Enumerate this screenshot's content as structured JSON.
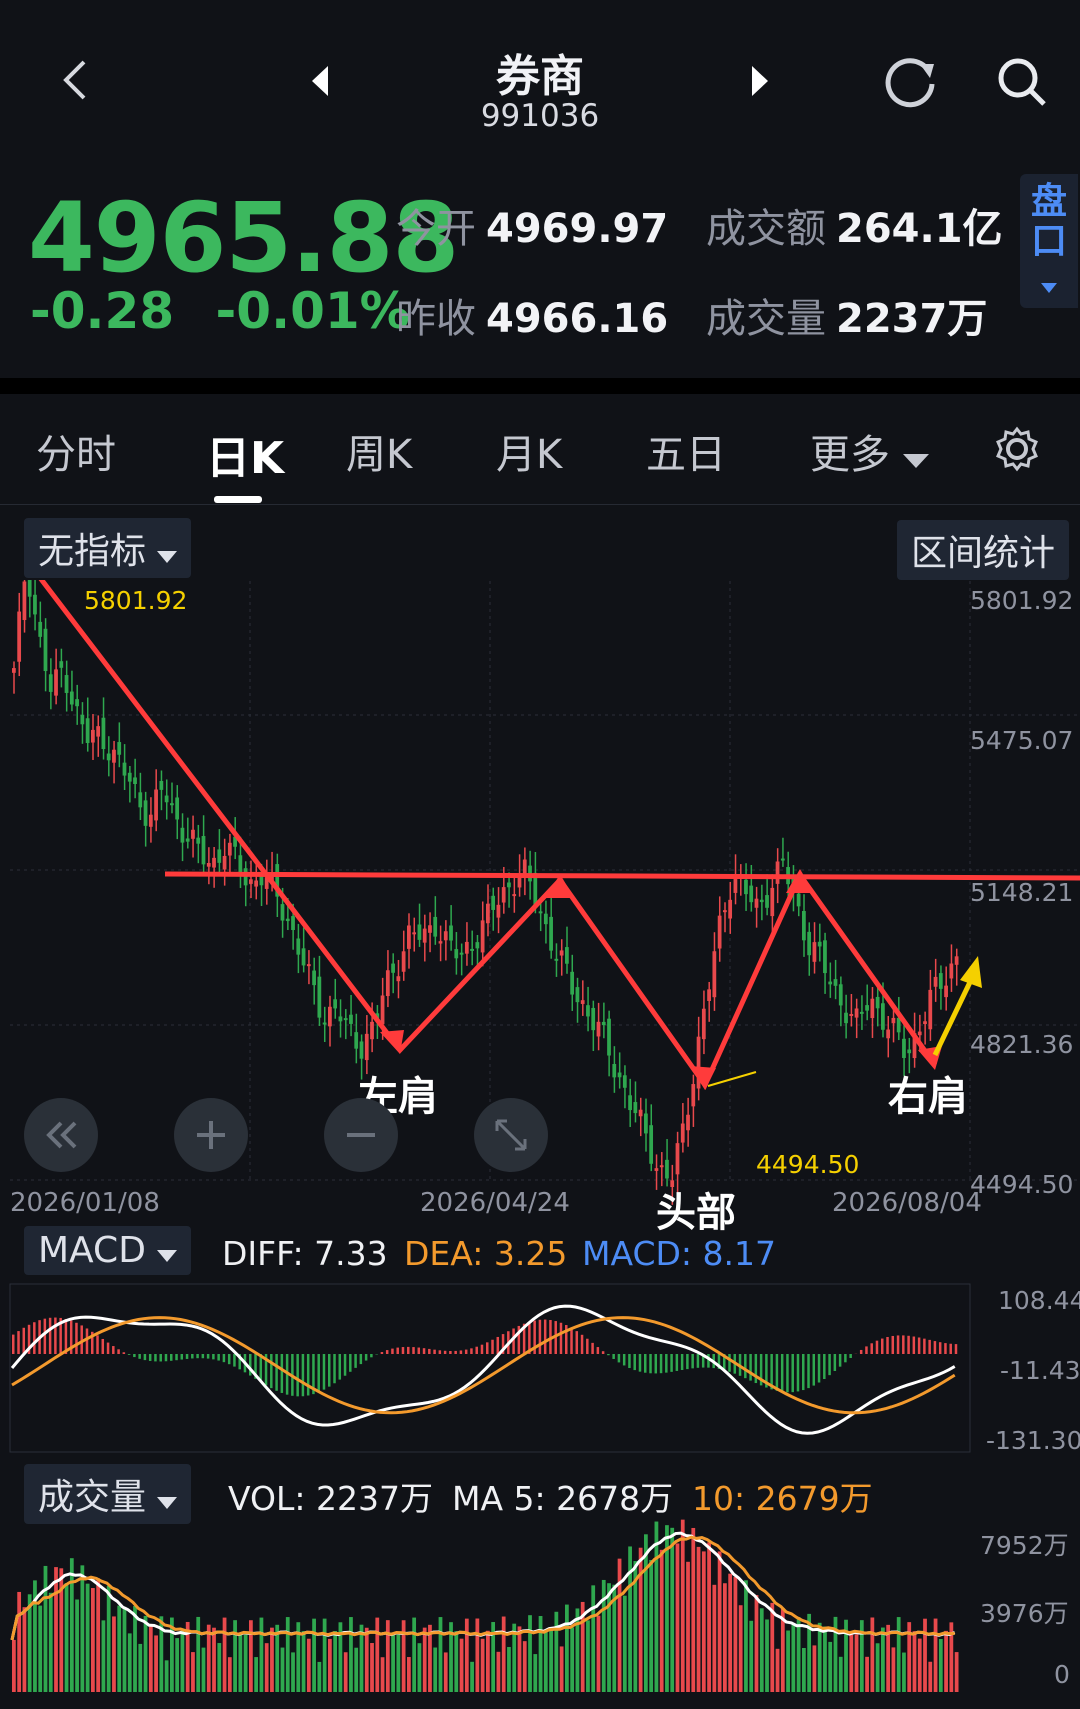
{
  "header": {
    "title": "券商",
    "code": "991036"
  },
  "quote": {
    "price": "4965.88",
    "change": "-0.28",
    "change_pct": "-0.01%",
    "open_label": "今开",
    "open": "4969.97",
    "prev_label": "昨收",
    "prev": "4966.16",
    "amount_label": "成交额",
    "amount": "264.1亿",
    "volume_label": "成交量",
    "volume": "2237万",
    "pankou": "盘口"
  },
  "tabs": [
    "分时",
    "日K",
    "周K",
    "月K",
    "五日",
    "更多"
  ],
  "main_chart": {
    "indicator_select": "无指标",
    "range_stats": "区间统计",
    "y_ticks": [
      "5801.92",
      "5475.07",
      "5148.21",
      "4821.36",
      "4494.50"
    ],
    "high_label": "5801.92",
    "low_label": "4494.50",
    "dates": [
      "2026/01/08",
      "2026/04/24",
      "2026/08/04"
    ],
    "annotations": {
      "left": "左肩",
      "head": "头部",
      "right": "右肩"
    }
  },
  "macd": {
    "select": "MACD",
    "diff": "DIFF: 7.33",
    "dea": "DEA: 3.25",
    "macd": "MACD: 8.17",
    "y_ticks": [
      "108.44",
      "-11.43",
      "-131.30"
    ]
  },
  "volume": {
    "select": "成交量",
    "vol": "VOL: 2237万",
    "ma5": "MA 5: 2678万",
    "ma10": "10: 2679万",
    "y_ticks": [
      "7952万",
      "3976万",
      "0"
    ]
  },
  "colors": {
    "up": "#e8494c",
    "down": "#2fa84f",
    "accent": "#4d8cf5",
    "annot": "#ff3b3b",
    "yellow": "#f5d000"
  },
  "chart_data": {
    "type": "candlestick",
    "x": [
      "2026/01/08",
      "2026/04/24",
      "2026/08/04"
    ],
    "ylim": [
      4494.5,
      5801.92
    ],
    "close": [
      5560,
      5801.92,
      5640,
      5520,
      5580,
      5480,
      5420,
      5440,
      5390,
      5350,
      5300,
      5260,
      5320,
      5260,
      5220,
      5180,
      5160,
      5200,
      5160,
      5120,
      5140,
      5100,
      5050,
      4980,
      4900,
      4840,
      4860,
      4800,
      4780,
      4821,
      4900,
      4960,
      5020,
      5000,
      5040,
      4990,
      4960,
      5000,
      5040,
      5080,
      5120,
      5148,
      5090,
      5020,
      4960,
      4900,
      4860,
      4820,
      4760,
      4700,
      4640,
      4580,
      4520,
      4494.5,
      4600,
      4760,
      4900,
      5040,
      5148,
      5100,
      5060,
      5120,
      5160,
      5080,
      5000,
      4960,
      4900,
      4860,
      4820,
      4880,
      4840,
      4800,
      4760,
      4820,
      4880,
      4920,
      4965.88
    ],
    "vol_max": "7952万"
  }
}
